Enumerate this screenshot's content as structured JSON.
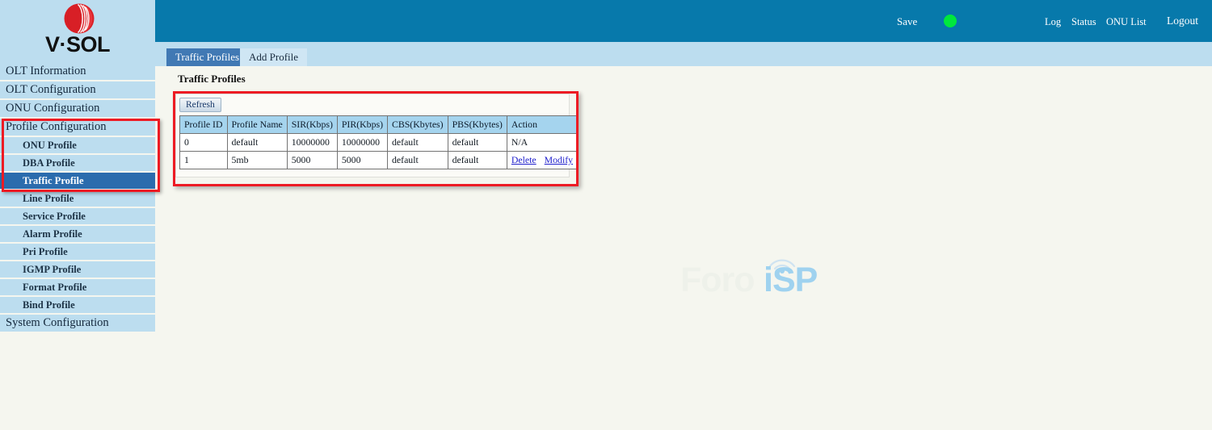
{
  "brand": {
    "logo_text": "V·SOL",
    "logo_icon": "vsol-sphere-logo"
  },
  "header": {
    "save_label": "Save",
    "status_indicator": "green-status-dot",
    "status_color": "#00e83c",
    "links": [
      {
        "label": "Log"
      },
      {
        "label": "Status"
      },
      {
        "label": "ONU List"
      },
      {
        "label": "Logout"
      }
    ],
    "background_color": "#0779ab"
  },
  "sidebar": {
    "background_color": "#bcddef",
    "active_color": "#2b6cad",
    "items": [
      {
        "label": "OLT Information",
        "level": "top",
        "active": false
      },
      {
        "label": "OLT Configuration",
        "level": "top",
        "active": false
      },
      {
        "label": "ONU Configuration",
        "level": "top",
        "active": false
      },
      {
        "label": "Profile Configuration",
        "level": "top",
        "active": false
      },
      {
        "label": "ONU Profile",
        "level": "sub",
        "active": false
      },
      {
        "label": "DBA Profile",
        "level": "sub",
        "active": false
      },
      {
        "label": "Traffic Profile",
        "level": "sub",
        "active": true
      },
      {
        "label": "Line Profile",
        "level": "sub",
        "active": false
      },
      {
        "label": "Service Profile",
        "level": "sub",
        "active": false
      },
      {
        "label": "Alarm Profile",
        "level": "sub",
        "active": false
      },
      {
        "label": "Pri Profile",
        "level": "sub",
        "active": false
      },
      {
        "label": "IGMP Profile",
        "level": "sub",
        "active": false
      },
      {
        "label": "Format Profile",
        "level": "sub",
        "active": false
      },
      {
        "label": "Bind Profile",
        "level": "sub",
        "active": false
      },
      {
        "label": "System Configuration",
        "level": "top",
        "active": false
      }
    ]
  },
  "tabs": [
    {
      "label": "Traffic Profiles",
      "active": true
    },
    {
      "label": "Add Profile",
      "active": false
    }
  ],
  "main": {
    "page_title": "Traffic Profiles",
    "refresh_label": "Refresh",
    "table": {
      "columns": [
        "Profile ID",
        "Profile Name",
        "SIR(Kbps)",
        "PIR(Kbps)",
        "CBS(Kbytes)",
        "PBS(Kbytes)",
        "Action"
      ],
      "rows": [
        {
          "profile_id": "0",
          "profile_name": "default",
          "sir": "10000000",
          "pir": "10000000",
          "cbs": "default",
          "pbs": "default",
          "action_text": "N/A",
          "has_links": false,
          "delete_label": "",
          "modify_label": ""
        },
        {
          "profile_id": "1",
          "profile_name": "5mb",
          "sir": "5000",
          "pir": "5000",
          "cbs": "default",
          "pbs": "default",
          "action_text": "",
          "has_links": true,
          "delete_label": "Delete",
          "modify_label": "Modify"
        }
      ]
    }
  },
  "watermark": {
    "text_light": "Foro",
    "text_accent": "iSP",
    "accent_color": "#9fd2ef",
    "icon": "signal-tower-icon"
  },
  "annotations": {
    "highlight_color": "#ed1b24",
    "boxes": [
      {
        "name": "sidebar-profile-config-highlight"
      },
      {
        "name": "traffic-profiles-table-highlight"
      }
    ]
  }
}
